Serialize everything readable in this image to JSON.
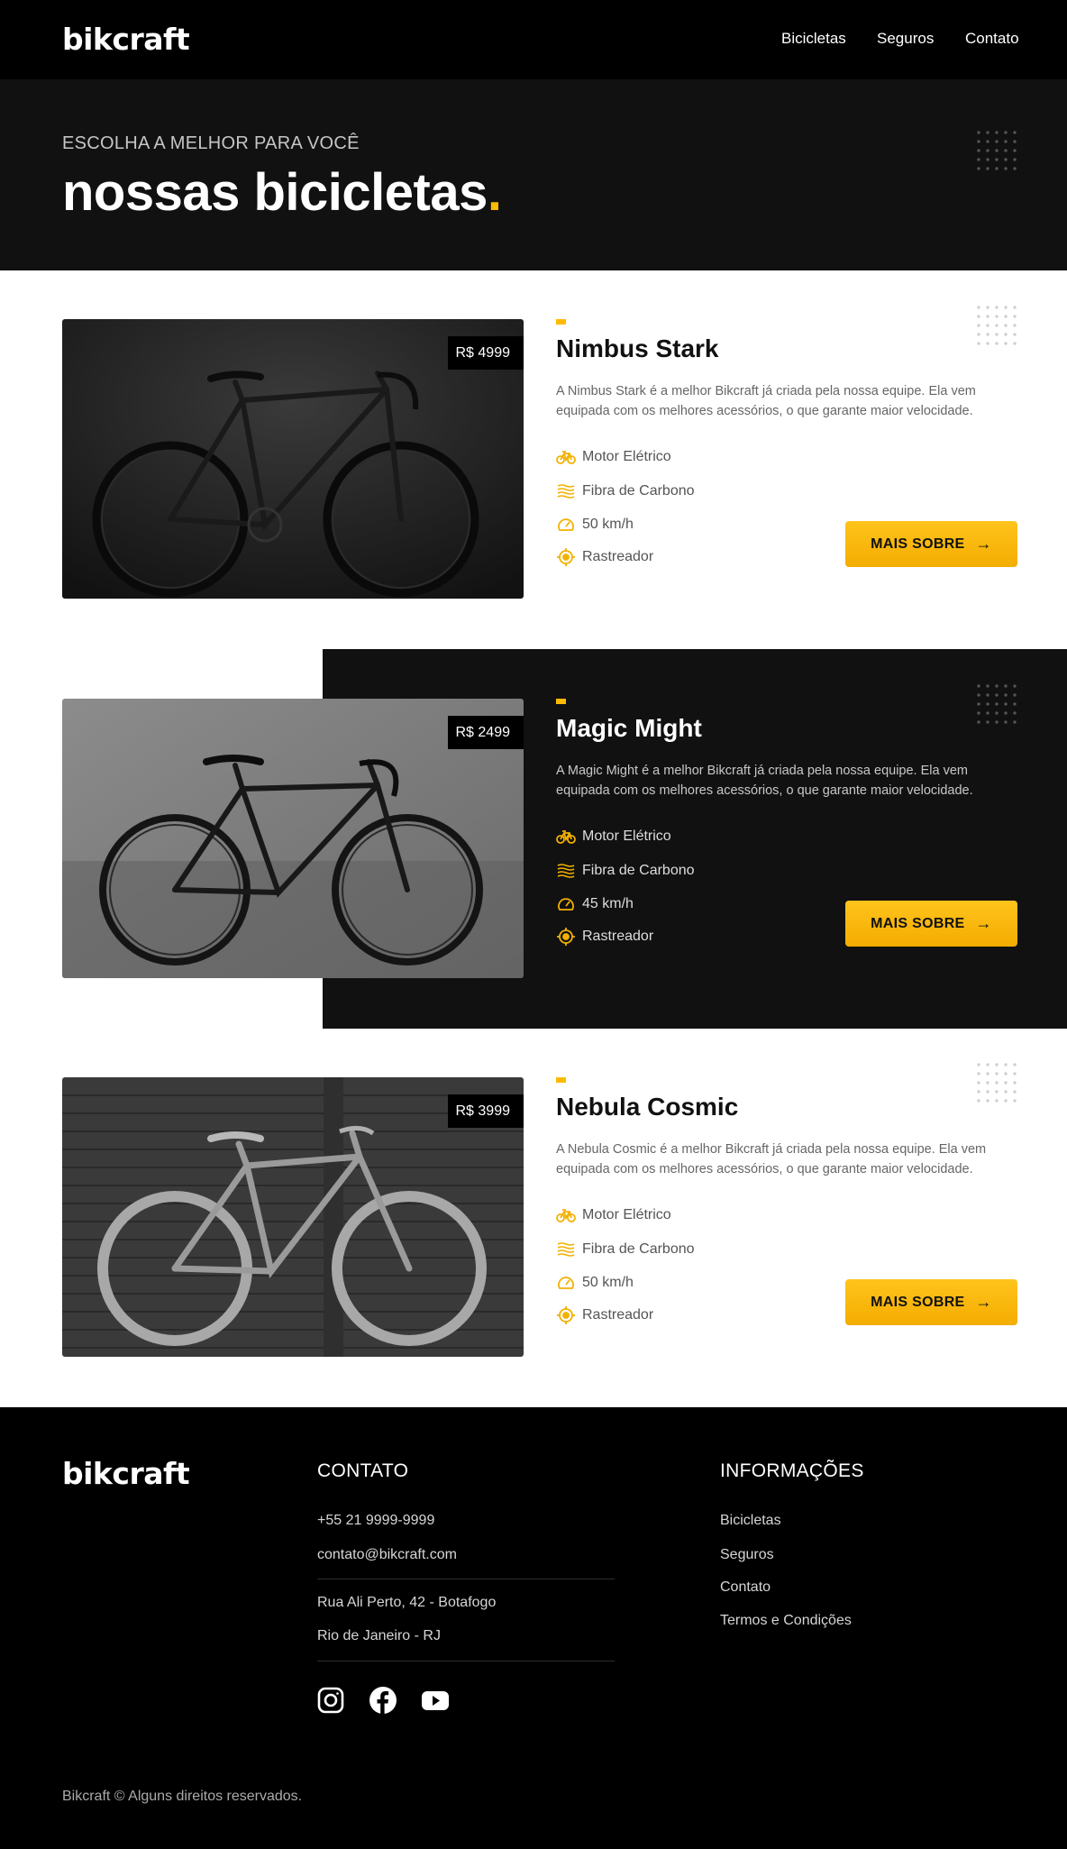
{
  "header": {
    "logo": "bikcraft",
    "nav": [
      "Bicicletas",
      "Seguros",
      "Contato"
    ]
  },
  "hero": {
    "subtitle": "ESCOLHA A MELHOR PARA VOCÊ",
    "title": "nossas bicicletas",
    "title_dot": "."
  },
  "bikes": [
    {
      "name": "Nimbus Stark",
      "price": "R$ 4999",
      "description": "A Nimbus Stark é a melhor Bikcraft já criada pela nossa equipe. Ela vem equipada com os melhores acessórios, o que garante maior velocidade.",
      "features": [
        "Motor Elétrico",
        "Fibra de Carbono",
        "50 km/h",
        "Rastreador"
      ],
      "button": "MAIS SOBRE"
    },
    {
      "name": "Magic Might",
      "price": "R$ 2499",
      "description": "A Magic Might é a melhor Bikcraft já criada pela nossa equipe. Ela vem equipada com os melhores acessórios, o que garante maior velocidade.",
      "features": [
        "Motor Elétrico",
        "Fibra de Carbono",
        "45 km/h",
        "Rastreador"
      ],
      "button": "MAIS SOBRE"
    },
    {
      "name": "Nebula Cosmic",
      "price": "R$ 3999",
      "description": "A Nebula Cosmic é a melhor Bikcraft já criada pela nossa equipe. Ela vem equipada com os melhores acessórios, o que garante maior velocidade.",
      "features": [
        "Motor Elétrico",
        "Fibra de Carbono",
        "50 km/h",
        "Rastreador"
      ],
      "button": "MAIS SOBRE"
    }
  ],
  "feature_icons": [
    "bike-icon",
    "carbon-fiber-icon",
    "speedometer-icon",
    "tracker-icon"
  ],
  "footer": {
    "logo": "bikcraft",
    "contact_title": "CONTATO",
    "phone": "+55 21 9999-9999",
    "email": "contato@bikcraft.com",
    "address_line1": "Rua Ali Perto, 42 - Botafogo",
    "address_line2": "Rio de Janeiro - RJ",
    "info_title": "INFORMAÇÕES",
    "info_links": [
      "Bicicletas",
      "Seguros",
      "Contato",
      "Termos e Condições"
    ],
    "social": [
      "instagram-icon",
      "facebook-icon",
      "youtube-icon"
    ],
    "copyright": "Bikcraft © Alguns direitos reservados."
  },
  "colors": {
    "accent": "#ffbb00",
    "dark": "#111111",
    "black": "#000000"
  }
}
